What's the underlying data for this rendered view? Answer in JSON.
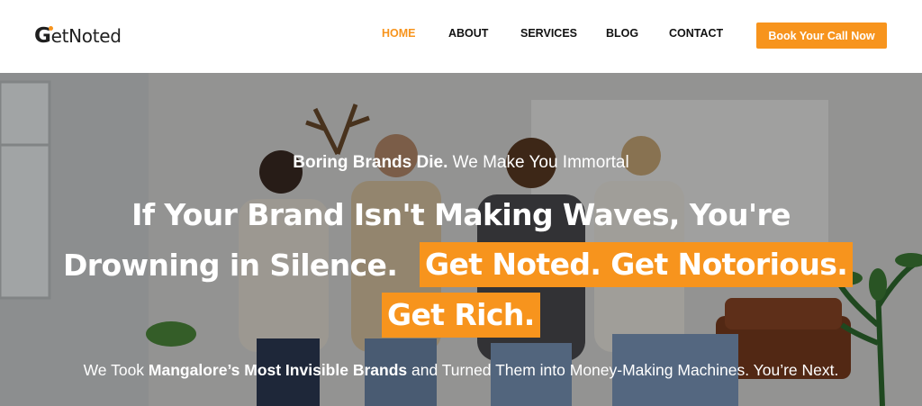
{
  "header": {
    "logo": {
      "first_letter": "G",
      "rest": "etNoted"
    },
    "nav": [
      {
        "label": "HOME",
        "active": true
      },
      {
        "label": "ABOUT",
        "active": false
      },
      {
        "label": "SERVICES",
        "active": false
      },
      {
        "label": "BLOG",
        "active": false
      },
      {
        "label": "CONTACT",
        "active": false
      }
    ],
    "cta_label": "Book Your Call Now"
  },
  "hero": {
    "subheading_bold": "Boring Brands Die.",
    "subheading_rest": " We Make You Immortal",
    "headline_line1": "If Your Brand Isn't Making Waves, You're",
    "headline_line2": "Drowning in Silence.",
    "highlight_1": "Get Noted. Get Notorious.",
    "highlight_2": "Get Rich.",
    "body_part1": "We Took ",
    "body_bold": "Mangalore’s Most Invisible Brands",
    "body_part2": " and Turned Them into Money-Making Machines. You’re Next."
  },
  "colors": {
    "accent": "#f7941d",
    "text_dark": "#111111",
    "hero_text": "#ffffff"
  }
}
